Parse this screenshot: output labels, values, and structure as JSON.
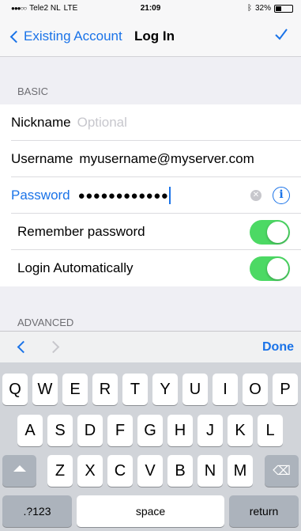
{
  "status_bar": {
    "carrier": "Tele2 NL",
    "network": "LTE",
    "time": "21:09",
    "battery_percent": "32%",
    "battery_level": 0.32
  },
  "nav": {
    "back_label": "Existing Account",
    "title": "Log In",
    "done_icon": "checkmark-icon"
  },
  "sections": {
    "basic": "BASIC",
    "advanced": "ADVANCED"
  },
  "fields": {
    "nickname": {
      "label": "Nickname",
      "placeholder": "Optional",
      "value": ""
    },
    "username": {
      "label": "Username",
      "value": "myusername@myserver.com"
    },
    "password": {
      "label": "Password",
      "value": "●●●●●●●●●●●●"
    }
  },
  "toggles": {
    "remember": {
      "label": "Remember password",
      "on": true
    },
    "auto_login": {
      "label": "Login Automatically",
      "on": true
    }
  },
  "accessory": {
    "done_label": "Done"
  },
  "keyboard": {
    "row1": [
      "Q",
      "W",
      "E",
      "R",
      "T",
      "Y",
      "U",
      "I",
      "O",
      "P"
    ],
    "row2": [
      "A",
      "S",
      "D",
      "F",
      "G",
      "H",
      "J",
      "K",
      "L"
    ],
    "row3": [
      "Z",
      "X",
      "C",
      "V",
      "B",
      "N",
      "M"
    ],
    "numbers_label": ".?123",
    "space_label": "space",
    "return_label": "return"
  },
  "colors": {
    "accent": "#1a73e8",
    "toggle_on": "#4cd964"
  }
}
